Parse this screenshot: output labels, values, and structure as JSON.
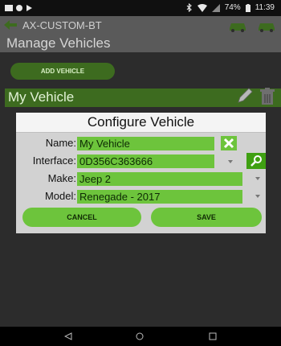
{
  "status_bar": {
    "battery_percent": "74%",
    "time": "11:39",
    "icons": [
      "gallery-icon",
      "circle-icon",
      "play-icon",
      "bluetooth-icon",
      "wifi-icon",
      "signal-icon",
      "battery-icon"
    ]
  },
  "app_bar": {
    "title": "AX-CUSTOM-BT",
    "page_title": "Manage Vehicles",
    "icons": [
      "back-arrow-icon",
      "car-icon",
      "car-icon"
    ]
  },
  "main": {
    "add_vehicle_label": "ADD VEHICLE",
    "vehicle_name": "My Vehicle",
    "row_icons": [
      "pencil-icon",
      "trash-icon"
    ]
  },
  "dialog": {
    "title": "Configure Vehicle",
    "name_label": "Name:",
    "name_value": "My Vehicle",
    "interface_label": "Interface:",
    "interface_value": "0D356C363666",
    "make_label": "Make:",
    "make_value": "Jeep 2",
    "model_label": "Model:",
    "model_value": "Renegade - 2017",
    "cancel_label": "CANCEL",
    "save_label": "SAVE"
  },
  "nav_bar": {
    "icons": [
      "back-triangle-icon",
      "home-circle-icon",
      "recents-square-icon"
    ]
  },
  "colors": {
    "accent_green": "#6dc43c",
    "dimmed_green": "#3d6b1f",
    "dialog_bg": "#d2d2d2"
  }
}
